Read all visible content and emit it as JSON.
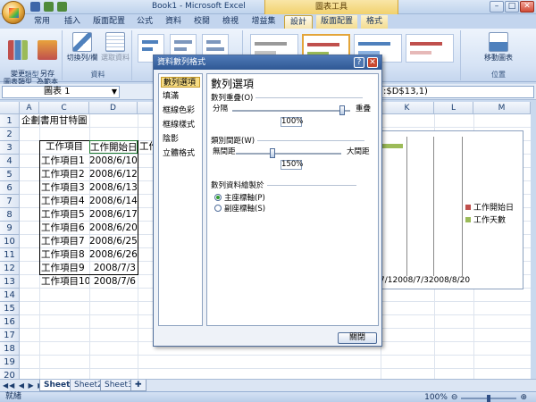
{
  "window": {
    "title": "Book1 - Microsoft Excel",
    "context_tab": "圖表工具"
  },
  "ribbon_tabs": [
    "常用",
    "插入",
    "版面配置",
    "公式",
    "資料",
    "校閱",
    "檢視",
    "增益集",
    "設計",
    "版面配置",
    "格式"
  ],
  "ribbon": {
    "change_type": "變更\n圖表類型",
    "save_template": "另存\n為範本",
    "group_type": "類型",
    "switch_rowcol": "切換列/欄",
    "select_data": "選取資料",
    "group_data": "資料",
    "move_chart": "移動圖表",
    "group_location": "位置"
  },
  "formula_bar": {
    "name_box": "圖表 1",
    "formula_fragment": ":$D$13,1)"
  },
  "grid": {
    "columns": [
      "A",
      "C",
      "D",
      "",
      "",
      "",
      "",
      "",
      "K",
      "L",
      "M"
    ],
    "rows": [
      "1",
      "2",
      "3",
      "4",
      "5",
      "6",
      "7",
      "8",
      "9",
      "10",
      "11",
      "12",
      "13",
      "14",
      "15",
      "16",
      "17",
      "18",
      "19",
      "20"
    ],
    "title_cell": "企劃書用甘特圖",
    "header_item": "工作項目",
    "header_start": "工作開始日",
    "header_extra": "工作",
    "tasks": [
      {
        "name": "工作項目1",
        "start": "2008/6/10"
      },
      {
        "name": "工作項目2",
        "start": "2008/6/12"
      },
      {
        "name": "工作項目3",
        "start": "2008/6/13"
      },
      {
        "name": "工作項目4",
        "start": "2008/6/14"
      },
      {
        "name": "工作項目5",
        "start": "2008/6/17"
      },
      {
        "name": "工作項目6",
        "start": "2008/6/20"
      },
      {
        "name": "工作項目7",
        "start": "2008/6/25"
      },
      {
        "name": "工作項目8",
        "start": "2008/6/26"
      },
      {
        "name": "工作項目9",
        "start": "2008/7/3"
      },
      {
        "name": "工作項目10",
        "start": "2008/7/6"
      }
    ]
  },
  "chart": {
    "legend": [
      {
        "name": "工作開始日",
        "color": "#c0504d"
      },
      {
        "name": "工作天數",
        "color": "#9bbb59"
      }
    ],
    "axis_fragment": "7/12008/7/32008/8/20"
  },
  "dialog": {
    "title": "資料數列格式",
    "nav": [
      "數列選項",
      "填滿",
      "框線色彩",
      "框線樣式",
      "陰影",
      "立體格式"
    ],
    "panel_title": "數列選項",
    "overlap_label": "數列重疊(O)",
    "overlap_left": "分隔",
    "overlap_right": "重疊",
    "overlap_value": "100%",
    "gap_label": "類別間距(W)",
    "gap_left": "無間距",
    "gap_right": "大間距",
    "gap_value": "150%",
    "plot_on_label": "數列資料繪製於",
    "primary_axis": "主座標軸(P)",
    "secondary_axis": "副座標軸(S)",
    "close_button": "關閉"
  },
  "sheets": [
    "Sheet1",
    "Sheet2",
    "Sheet3"
  ],
  "status": {
    "ready": "就緒",
    "zoom": "100%"
  }
}
